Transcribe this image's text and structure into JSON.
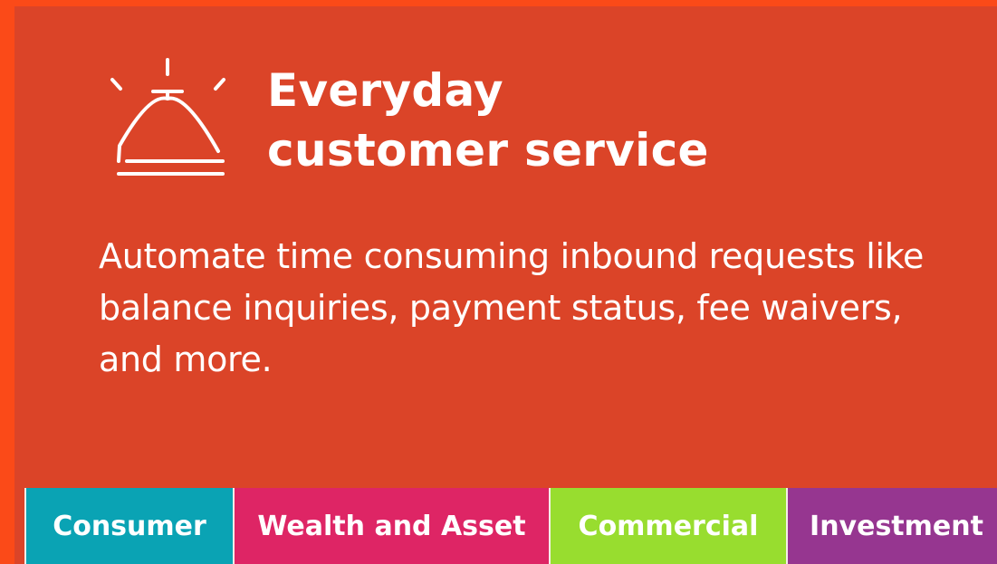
{
  "card": {
    "title_line_1": "Everyday",
    "title_line_2": "customer service",
    "description": "Automate time consuming inbound requests like balance inquiries, payment status, fee waivers, and more.",
    "icon": "service-bell-icon"
  },
  "tabs": [
    {
      "label": "Consumer",
      "color": "#0aa3b4"
    },
    {
      "label": "Wealth and Asset",
      "color": "#de2565"
    },
    {
      "label": "Commercial",
      "color": "#98dd2f"
    },
    {
      "label": "Investment",
      "color": "#963690"
    }
  ],
  "colors": {
    "page_background": "#fb4a18",
    "card_background": "#db4428",
    "text": "#ffffff"
  }
}
